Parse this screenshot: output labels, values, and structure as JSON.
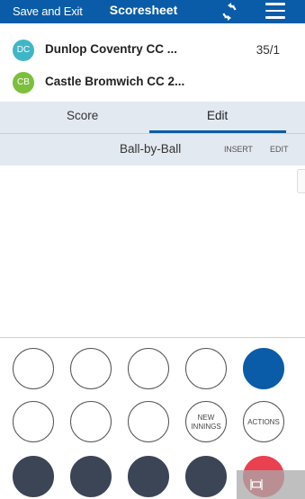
{
  "header": {
    "save_label": "Save and Exit",
    "title": "Scoresheet",
    "sync_icon": "sync-icon",
    "menu_icon": "hamburger-menu-icon",
    "background": "#0a5ca8"
  },
  "teams": [
    {
      "initials": "DC",
      "name": "Dunlop Coventry CC ...",
      "score": "35/1",
      "color": "#3fb6c6"
    },
    {
      "initials": "CB",
      "name": "Castle Bromwich CC 2...",
      "score": "",
      "color": "#7cbf3d"
    }
  ],
  "tabs": {
    "score_label": "Score",
    "edit_label": "Edit",
    "active": "Edit"
  },
  "subbar": {
    "title": "Ball-by-Ball",
    "insert_label": "INSERT",
    "edit_label": "EDIT"
  },
  "keypad": {
    "new_innings_line1": "NEW",
    "new_innings_line2": "INNINGS",
    "actions_label": "ACTIONS",
    "accent_blue": "#0a5ca8",
    "dark": "#3c4555",
    "red": "#e94150"
  },
  "overlay": {
    "icon": "screen-capture-icon"
  }
}
